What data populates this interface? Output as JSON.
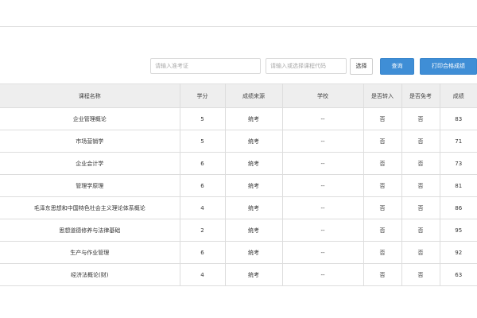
{
  "search": {
    "exam_placeholder": "请输入准考证",
    "course_placeholder": "请输入或选择课程代码",
    "select_label": "选择",
    "query_label": "查询",
    "print_label": "打印合格成绩"
  },
  "table": {
    "headers": [
      "课程名称",
      "学分",
      "成绩来源",
      "学校",
      "是否转入",
      "是否免考",
      "成绩"
    ],
    "rows": [
      {
        "course": "企业管理概论",
        "credit": "5",
        "source": "统考",
        "school": "--",
        "transferred": "否",
        "exempt": "否",
        "score": "83"
      },
      {
        "course": "市场营销学",
        "credit": "5",
        "source": "统考",
        "school": "--",
        "transferred": "否",
        "exempt": "否",
        "score": "71"
      },
      {
        "course": "企业会计学",
        "credit": "6",
        "source": "统考",
        "school": "--",
        "transferred": "否",
        "exempt": "否",
        "score": "73"
      },
      {
        "course": "管理学原理",
        "credit": "6",
        "source": "统考",
        "school": "--",
        "transferred": "否",
        "exempt": "否",
        "score": "81"
      },
      {
        "course": "毛泽东思想和中国特色社会主义理论体系概论",
        "credit": "4",
        "source": "统考",
        "school": "--",
        "transferred": "否",
        "exempt": "否",
        "score": "86"
      },
      {
        "course": "思想道德修养与法律基础",
        "credit": "2",
        "source": "统考",
        "school": "--",
        "transferred": "否",
        "exempt": "否",
        "score": "95"
      },
      {
        "course": "生产与作业管理",
        "credit": "6",
        "source": "统考",
        "school": "--",
        "transferred": "否",
        "exempt": "否",
        "score": "92"
      },
      {
        "course": "经济法概论(财)",
        "credit": "4",
        "source": "统考",
        "school": "--",
        "transferred": "否",
        "exempt": "否",
        "score": "63"
      }
    ]
  },
  "colors": {
    "primary": "#3f8ed6",
    "header_bg": "#eeeeee",
    "border": "#dddddd"
  }
}
